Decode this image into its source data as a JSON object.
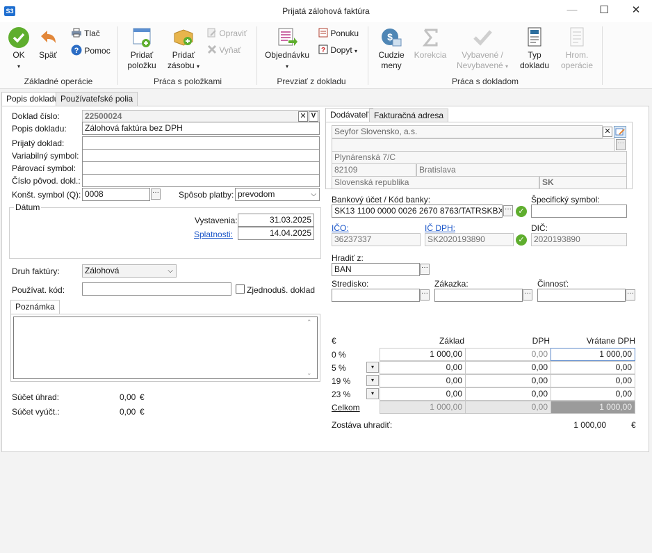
{
  "window": {
    "app_logo": "S3",
    "title": "Prijatá zálohová faktúra",
    "minimize": "—",
    "maximize": "☐",
    "close": "✕"
  },
  "ribbon": {
    "groups": {
      "basic": "Základné operácie",
      "items": "Práca s položkami",
      "import": "Prevziať z dokladu",
      "doc": "Práca s dokladom"
    },
    "ok": "OK",
    "back": "Späť",
    "print": "Tlač",
    "help": "Pomoc",
    "add_item_1": "Pridať",
    "add_item_2": "položku",
    "add_stock_1": "Pridať",
    "add_stock_2": "zásobu",
    "edit": "Opraviť",
    "remove": "Vyňať",
    "order": "Objednávku",
    "offer": "Ponuku",
    "inquiry": "Dopyt",
    "foreign_1": "Cudzie",
    "foreign_2": "meny",
    "correction": "Korekcia",
    "selected_1": "Vybavené /",
    "selected_2": "Nevybavené",
    "doctype_1": "Typ",
    "doctype_2": "dokladu",
    "bulk_1": "Hrom.",
    "bulk_2": "operácie"
  },
  "tabs": {
    "main": "Popis dokladu",
    "user": "Používateľské polia"
  },
  "form": {
    "doc_number_label": "Doklad číslo:",
    "doc_number": "22500024",
    "desc_label": "Popis dokladu:",
    "desc": "Zálohová faktúra bez DPH",
    "received_label": "Prijatý doklad:",
    "received": "",
    "var_label": "Variabilný symbol:",
    "var": "",
    "pair_label": "Párovací symbol:",
    "pair": "",
    "orig_label": "Číslo pôvod. dokl.:",
    "orig": "",
    "const_label": "Konšt. symbol (Q):",
    "const": "0008",
    "pay_label": "Spôsob platby:",
    "pay": "prevodom",
    "date_group": "Dátum",
    "issue_label": "Vystavenia:",
    "issue": "31.03.2025",
    "due_label": "Splatnosti:",
    "due": "14.04.2025",
    "kind_label": "Druh faktúry:",
    "kind": "Zálohová",
    "user_code_label": "Používat. kód:",
    "user_code": "",
    "simplified_label": "Zjednoduš. doklad",
    "note_tab": "Poznámka",
    "note": "",
    "pay_sum_label": "Súčet úhrad:",
    "pay_sum": "0,00",
    "bill_sum_label": "Súčet vyúčt.:",
    "bill_sum": "0,00",
    "currency": "€"
  },
  "supplier": {
    "tab_supplier": "Dodávateľ",
    "tab_invoice": "Fakturačná adresa",
    "name": "Seyfor Slovensko, a.s.",
    "name2": "",
    "street": "Plynárenská 7/C",
    "zip": "82109",
    "city": "Bratislava",
    "country": "Slovenská republika",
    "country_code": "SK",
    "bank_label": "Bankový účet / Kód banky:",
    "bank": "SK13 1100 0000 0026 2670 8763/TATRSKBX",
    "spec_label": "Špecifický symbol:",
    "spec": "",
    "ico_label": "IČO:",
    "ico": "36237337",
    "icdph_label": "IČ DPH:",
    "icdph": "SK2020193890",
    "dic_label": "DIČ:",
    "dic": "2020193890",
    "pay_from_label": "Hradiť z:",
    "pay_from": "BAN",
    "center_label": "Stredisko:",
    "center": "",
    "contract_label": "Zákazka:",
    "contract": "",
    "activity_label": "Činnosť:",
    "activity": ""
  },
  "vat": {
    "currency": "€",
    "col_base": "Základ",
    "col_vat": "DPH",
    "col_total": "Vrátane DPH",
    "rows": [
      {
        "rate": "0 %",
        "base": "1 000,00",
        "vat": "0,00",
        "total": "1 000,00"
      },
      {
        "rate": "5 %",
        "base": "0,00",
        "vat": "0,00",
        "total": "0,00"
      },
      {
        "rate": "19 %",
        "base": "0,00",
        "vat": "0,00",
        "total": "0,00"
      },
      {
        "rate": "23 %",
        "base": "0,00",
        "vat": "0,00",
        "total": "0,00"
      }
    ],
    "sum_label": "Celkom",
    "sum_base": "1 000,00",
    "sum_vat": "0,00",
    "sum_total": "1 000,00",
    "remaining_label": "Zostáva uhradiť:",
    "remaining": "1 000,00",
    "remaining_currency": "€"
  },
  "icons": {
    "ok": "check-circle-icon",
    "back": "undo-arrow-icon",
    "print": "printer-icon",
    "help": "question-circle-icon",
    "add_item": "document-add-icon",
    "add_stock": "box-add-icon",
    "edit": "edit-icon",
    "remove": "remove-icon",
    "order": "order-import-icon",
    "offer": "offer-icon",
    "inquiry": "inquiry-icon",
    "foreign": "currency-icon",
    "correction": "sigma-icon",
    "selected": "checkmark-icon",
    "doctype": "doctype-icon",
    "bulk": "bulk-ops-icon"
  },
  "colors": {
    "accent": "#1a55c8",
    "ok_green": "#5fae2e",
    "back_orange": "#e2873a"
  }
}
